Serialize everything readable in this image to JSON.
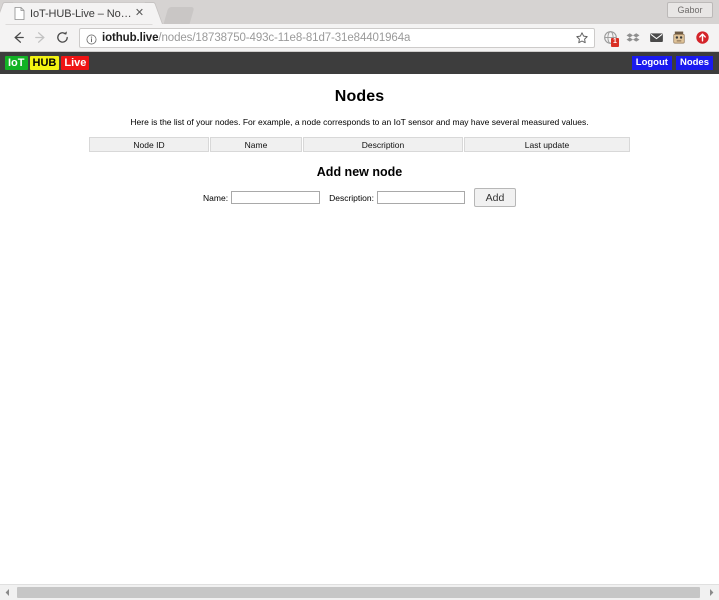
{
  "browser": {
    "tab": {
      "title": "IoT-HUB-Live – Nodes",
      "close_label": "✕",
      "favicon_icon": "page-icon"
    },
    "profile": {
      "name": "Gabor"
    },
    "nav": {
      "back_icon": "back-arrow-icon",
      "forward_icon": "forward-arrow-icon",
      "reload_icon": "reload-icon"
    },
    "omnibox": {
      "info_icon": "info-circle-icon",
      "url_host": "iothub.live",
      "url_path": "/nodes/18738750-493c-11e8-81d7-31e84401964a",
      "full_url": "iothub.live/nodes/18738750-493c-11e8-81d7-31e84401964a",
      "star_icon": "bookmark-star-icon"
    },
    "extensions": [
      {
        "icon": "globe-extension-icon",
        "badge": "1",
        "badge_color": "#d93025"
      },
      {
        "icon": "dropbox-extension-icon",
        "badge": ""
      },
      {
        "icon": "mail-envelope-icon",
        "badge": ""
      },
      {
        "icon": "robot-extension-icon",
        "badge": ""
      },
      {
        "icon": "red-arrow-download-icon",
        "badge": ""
      }
    ]
  },
  "site": {
    "header": {
      "logo": {
        "part1": "IoT",
        "part2": "HUB",
        "part3": "Live",
        "color1": "#12b224",
        "color2": "#f3f312",
        "color3": "#ef1414"
      },
      "nav_links": [
        {
          "label": "Logout"
        },
        {
          "label": "Nodes"
        }
      ],
      "background": "#3d3d3d",
      "link_background": "#1a1aef"
    },
    "main": {
      "title": "Nodes",
      "description": "Here is the list of your nodes. For example, a node corresponds to an IoT sensor and may have several measured values.",
      "table": {
        "headers": [
          "Node ID",
          "Name",
          "Description",
          "Last update"
        ],
        "rows": []
      },
      "form": {
        "title": "Add new node",
        "name_label": "Name:",
        "name_value": "",
        "name_placeholder": "",
        "description_label": "Description:",
        "description_value": "",
        "description_placeholder": "",
        "submit_label": "Add"
      }
    }
  },
  "scrollbar": {
    "left_arrow": "◂",
    "right_arrow": "▸"
  }
}
